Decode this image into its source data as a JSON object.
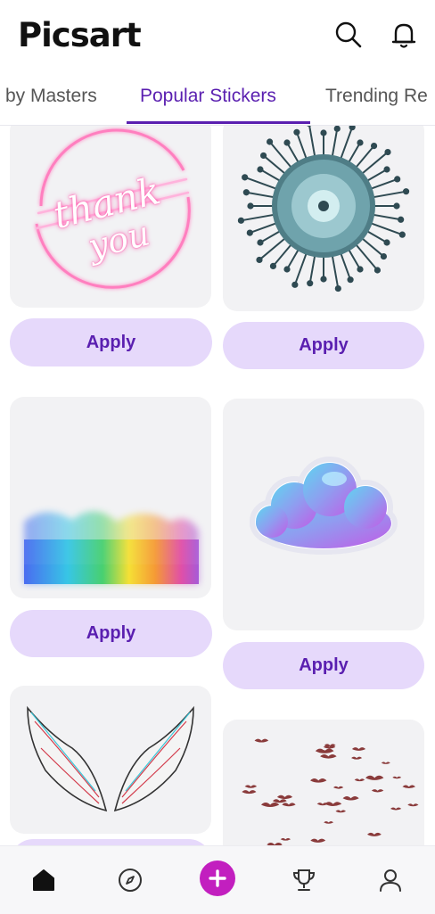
{
  "app": {
    "logo_text": "Picsart"
  },
  "header": {
    "search_icon": "search-icon",
    "notification_icon": "bell-icon"
  },
  "tabs": [
    {
      "label": "by Masters"
    },
    {
      "label": "Popular Stickers",
      "active": true
    },
    {
      "label": "Trending Re"
    }
  ],
  "cards": [
    {
      "sticker": "neon-thank-you-sticker",
      "sticker_text_line1": "thank",
      "sticker_text_line2": "you",
      "apply_label": "Apply"
    },
    {
      "sticker": "virus-sticker",
      "apply_label": "Apply"
    },
    {
      "sticker": "rainbow-watercolor-sticker",
      "apply_label": "Apply"
    },
    {
      "sticker": "cloud-sticker",
      "apply_label": "Apply"
    },
    {
      "sticker": "wings-sticker"
    },
    {
      "sticker": "birds-sticker"
    }
  ],
  "bottom_nav": [
    {
      "icon": "home-icon",
      "active": true
    },
    {
      "icon": "compass-icon"
    },
    {
      "icon": "plus-icon"
    },
    {
      "icon": "trophy-icon"
    },
    {
      "icon": "profile-icon"
    }
  ],
  "colors": {
    "accent": "#5a1fb0",
    "apply_bg": "#e6d9fb",
    "create_button": "#c21fbf",
    "card_bg": "#f2f2f4"
  }
}
